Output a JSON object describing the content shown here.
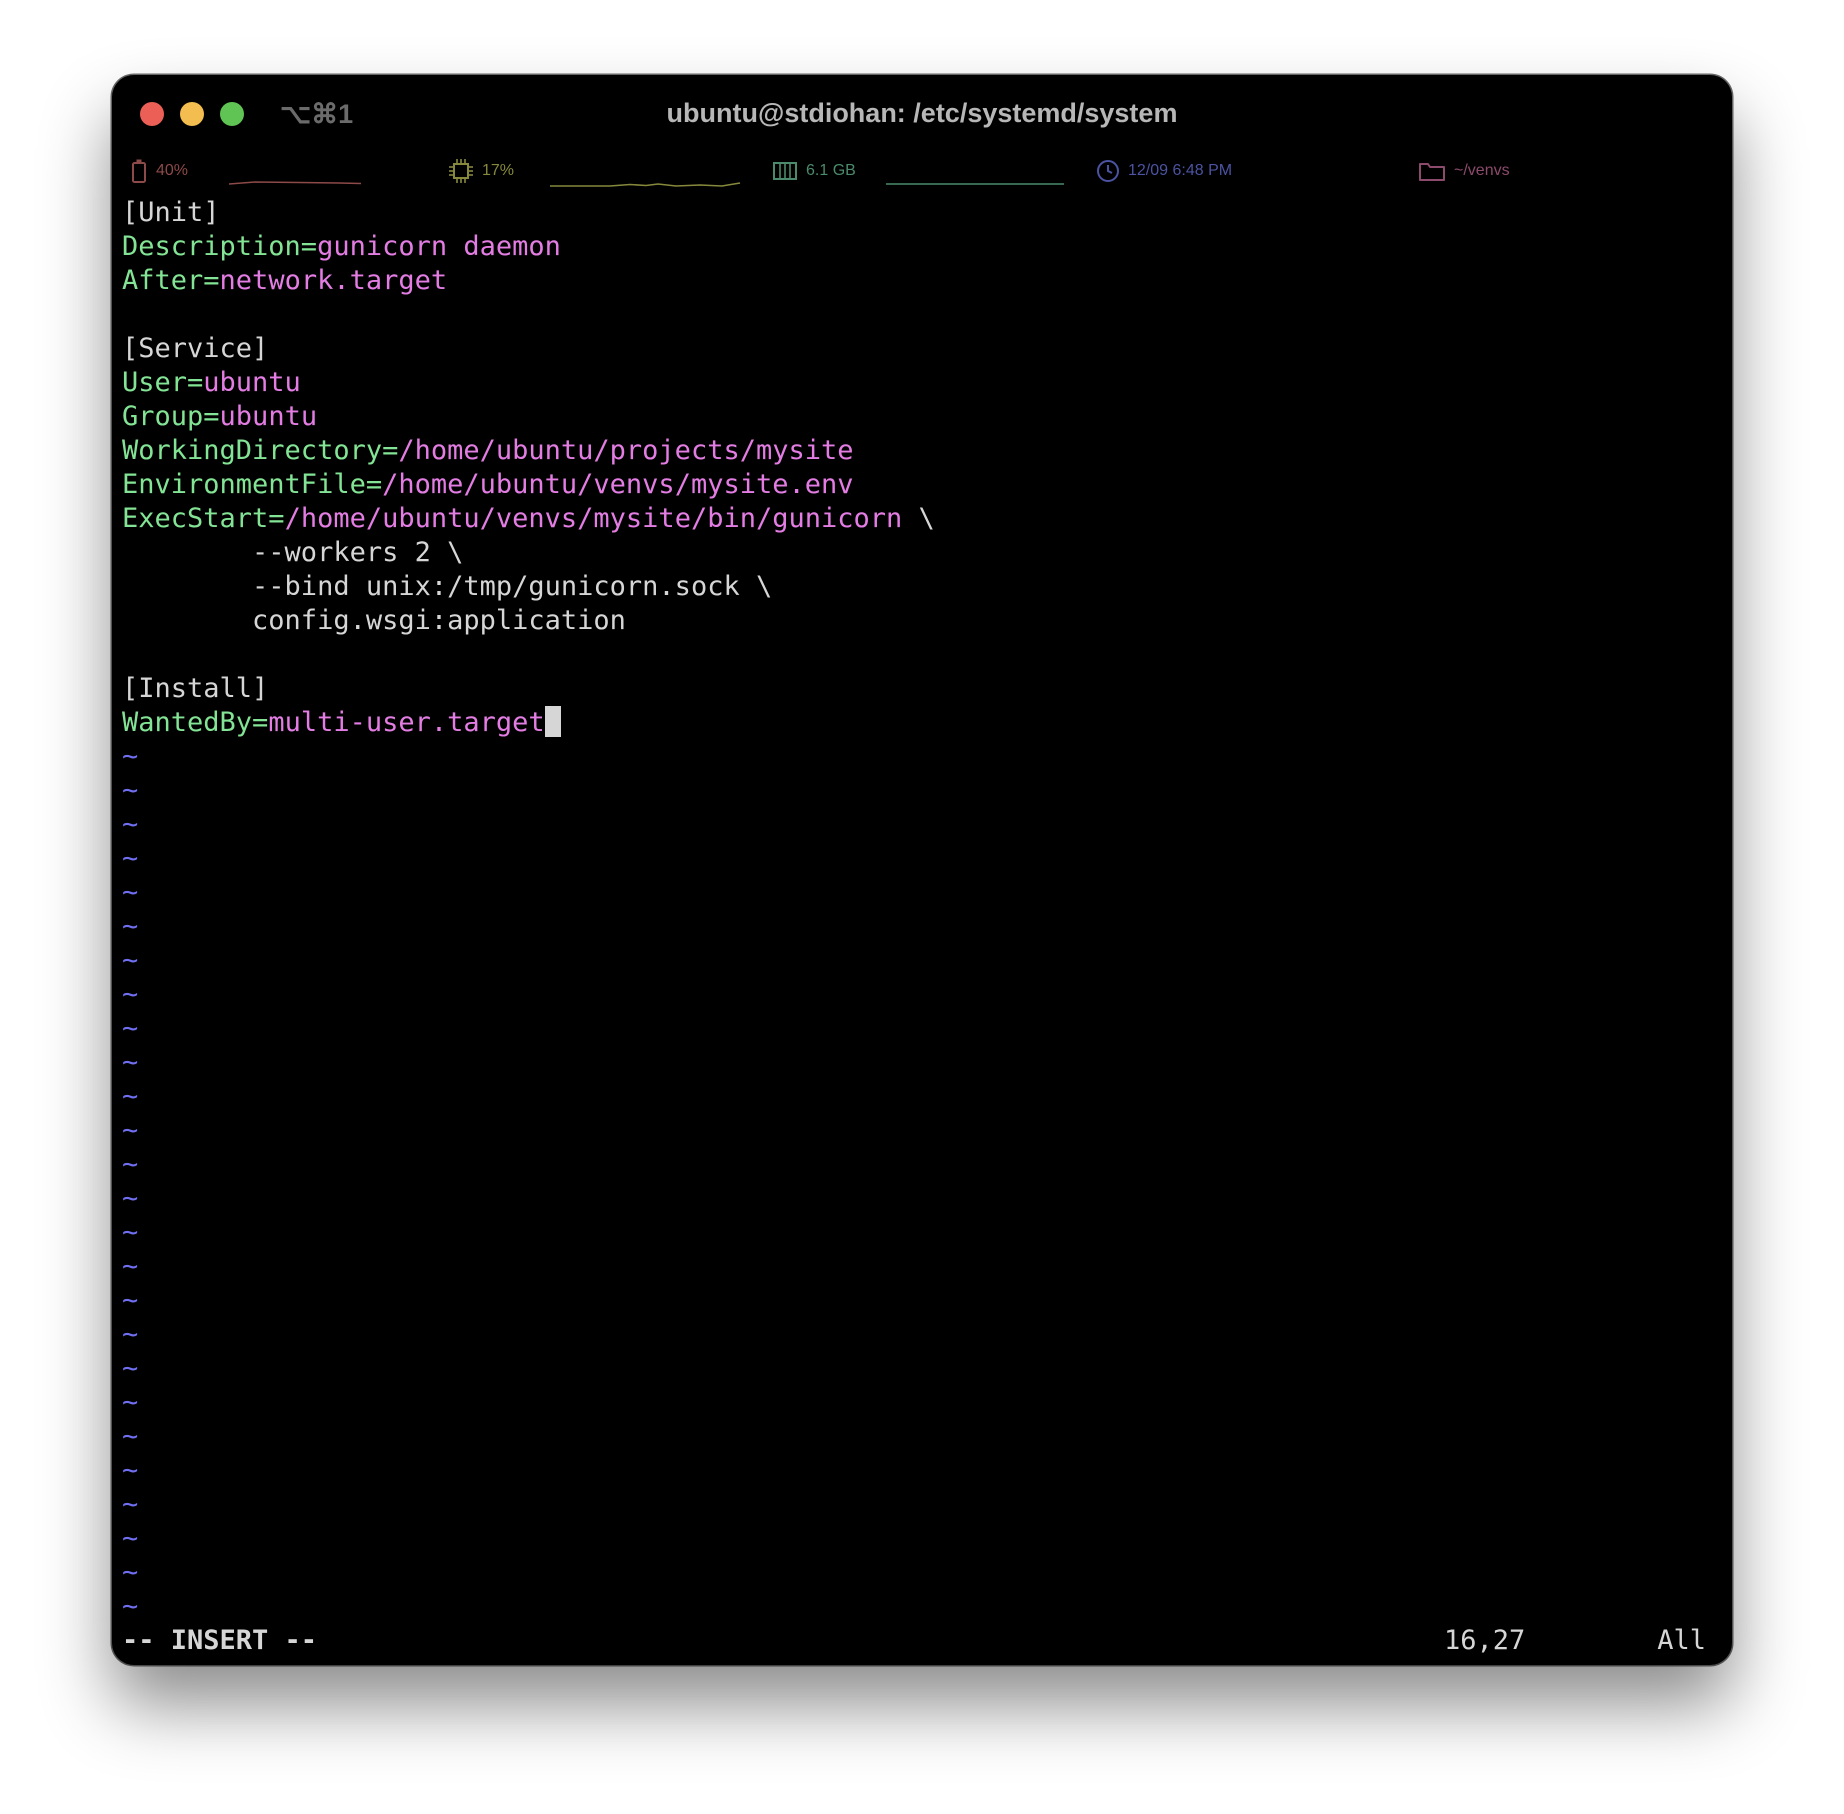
{
  "window": {
    "title": "ubuntu@stdiohan: /etc/systemd/system",
    "shortcut": "⌥⌘1"
  },
  "status": {
    "battery": "40%",
    "cpu": "17%",
    "memory": "6.1 GB",
    "clock": "12/09 6:48 PM",
    "directory": "~/venvs"
  },
  "editor": {
    "lines": [
      {
        "type": "header",
        "text": "[Unit]"
      },
      {
        "type": "kv",
        "key": "Description=",
        "value": "gunicorn daemon"
      },
      {
        "type": "kv",
        "key": "After=",
        "value": "network.target"
      },
      {
        "type": "blank"
      },
      {
        "type": "header",
        "text": "[Service]"
      },
      {
        "type": "kv",
        "key": "User=",
        "value": "ubuntu"
      },
      {
        "type": "kv",
        "key": "Group=",
        "value": "ubuntu"
      },
      {
        "type": "kv",
        "key": "WorkingDirectory=",
        "value": "/home/ubuntu/projects/mysite"
      },
      {
        "type": "kv",
        "key": "EnvironmentFile=",
        "value": "/home/ubuntu/venvs/mysite.env"
      },
      {
        "type": "kv",
        "key": "ExecStart=",
        "value": "/home/ubuntu/venvs/mysite/bin/gunicorn",
        "suffix": " \\"
      },
      {
        "type": "plain",
        "text": "        --workers 2 \\"
      },
      {
        "type": "plain",
        "text": "        --bind unix:/tmp/gunicorn.sock \\"
      },
      {
        "type": "plain",
        "text": "        config.wsgi:application"
      },
      {
        "type": "blank"
      },
      {
        "type": "header",
        "text": "[Install]"
      },
      {
        "type": "kv",
        "key": "WantedBy=",
        "value": "multi-user.target",
        "cursor": true
      }
    ],
    "tilde_count": 26,
    "tilde_char": "~"
  },
  "modeline": {
    "mode": "-- INSERT --",
    "position": "16,27",
    "scroll": "All"
  },
  "colors": {
    "key": "#82e494",
    "value": "#e37de3",
    "tilde": "#6f6ff2",
    "battery": "#8c4a48",
    "cpu": "#86893c",
    "memory": "#4b8a6a",
    "clock": "#4b53a2",
    "directory": "#8c4a6c"
  }
}
